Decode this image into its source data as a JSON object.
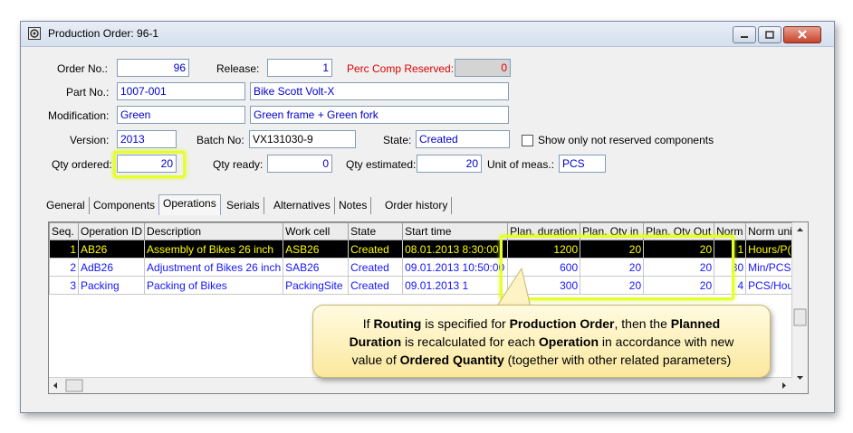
{
  "window": {
    "title": "Production Order: 96-1"
  },
  "form": {
    "order_no_label": "Order No.:",
    "order_no": "96",
    "release_label": "Release:",
    "release": "1",
    "perc_label": "Perc Comp Reserved:",
    "perc": "0",
    "part_no_label": "Part No.:",
    "part_no": "1007-001",
    "part_name": "Bike Scott Volt-X",
    "modification_label": "Modification:",
    "modification": "Green",
    "modification_desc": "Green frame + Green fork",
    "version_label": "Version:",
    "version": "2013",
    "batch_label": "Batch No:",
    "batch": "VX131030-9",
    "state_label": "State:",
    "state": "Created",
    "show_only_label": "Show only not reserved components",
    "qty_ordered_label": "Qty ordered:",
    "qty_ordered": "20",
    "qty_ready_label": "Qty ready:",
    "qty_ready": "0",
    "qty_est_label": "Qty estimated:",
    "qty_est": "20",
    "unit_label": "Unit of meas.:",
    "unit": "PCS"
  },
  "tabs": [
    "General",
    "Components",
    "Operations",
    "Serials",
    "Alternatives",
    "Notes",
    "Order history"
  ],
  "active_tab": "Operations",
  "grid": {
    "columns": [
      "Seq.",
      "Operation ID",
      "Description",
      "Work cell",
      "State",
      "Start time",
      "Plan. duration",
      "Plan. Qty in",
      "Plan. Qty Out",
      "Norm",
      "Norm uni"
    ],
    "rows": [
      [
        "1",
        "AB26",
        "Assembly of Bikes 26 inch",
        "ASB26",
        "Created",
        "08.01.2013 8:30:00",
        "1200",
        "20",
        "20",
        "1",
        "Hours/P("
      ],
      [
        "2",
        "AdB26",
        "Adjustment of Bikes 26 inch",
        "SAB26",
        "Created",
        "09.01.2013 10:50:00",
        "600",
        "20",
        "20",
        "30",
        "Min/PCS"
      ],
      [
        "3",
        "Packing",
        "Packing of Bikes",
        "PackingSite",
        "Created",
        "09.01.2013 1",
        "300",
        "20",
        "20",
        "4",
        "PCS/Hou"
      ]
    ]
  },
  "callout": {
    "t1": "If ",
    "b1": "Routing",
    "t2": " is specified for ",
    "b2": "Production Order",
    "t3": ", then the ",
    "b3": "Planned",
    "b4": "Duration",
    "t4": " is recalculated for each ",
    "b5": "Operation",
    "t5": " in accordance with new",
    "t6": "value of ",
    "b6": "Ordered Quantity",
    "t7": " (together with other related parameters)"
  },
  "colors": {
    "highlight": "#e6ff2b",
    "field_text": "#0000d0",
    "selected_row_bg": "#000000",
    "selected_row_text": "#ffff00"
  }
}
